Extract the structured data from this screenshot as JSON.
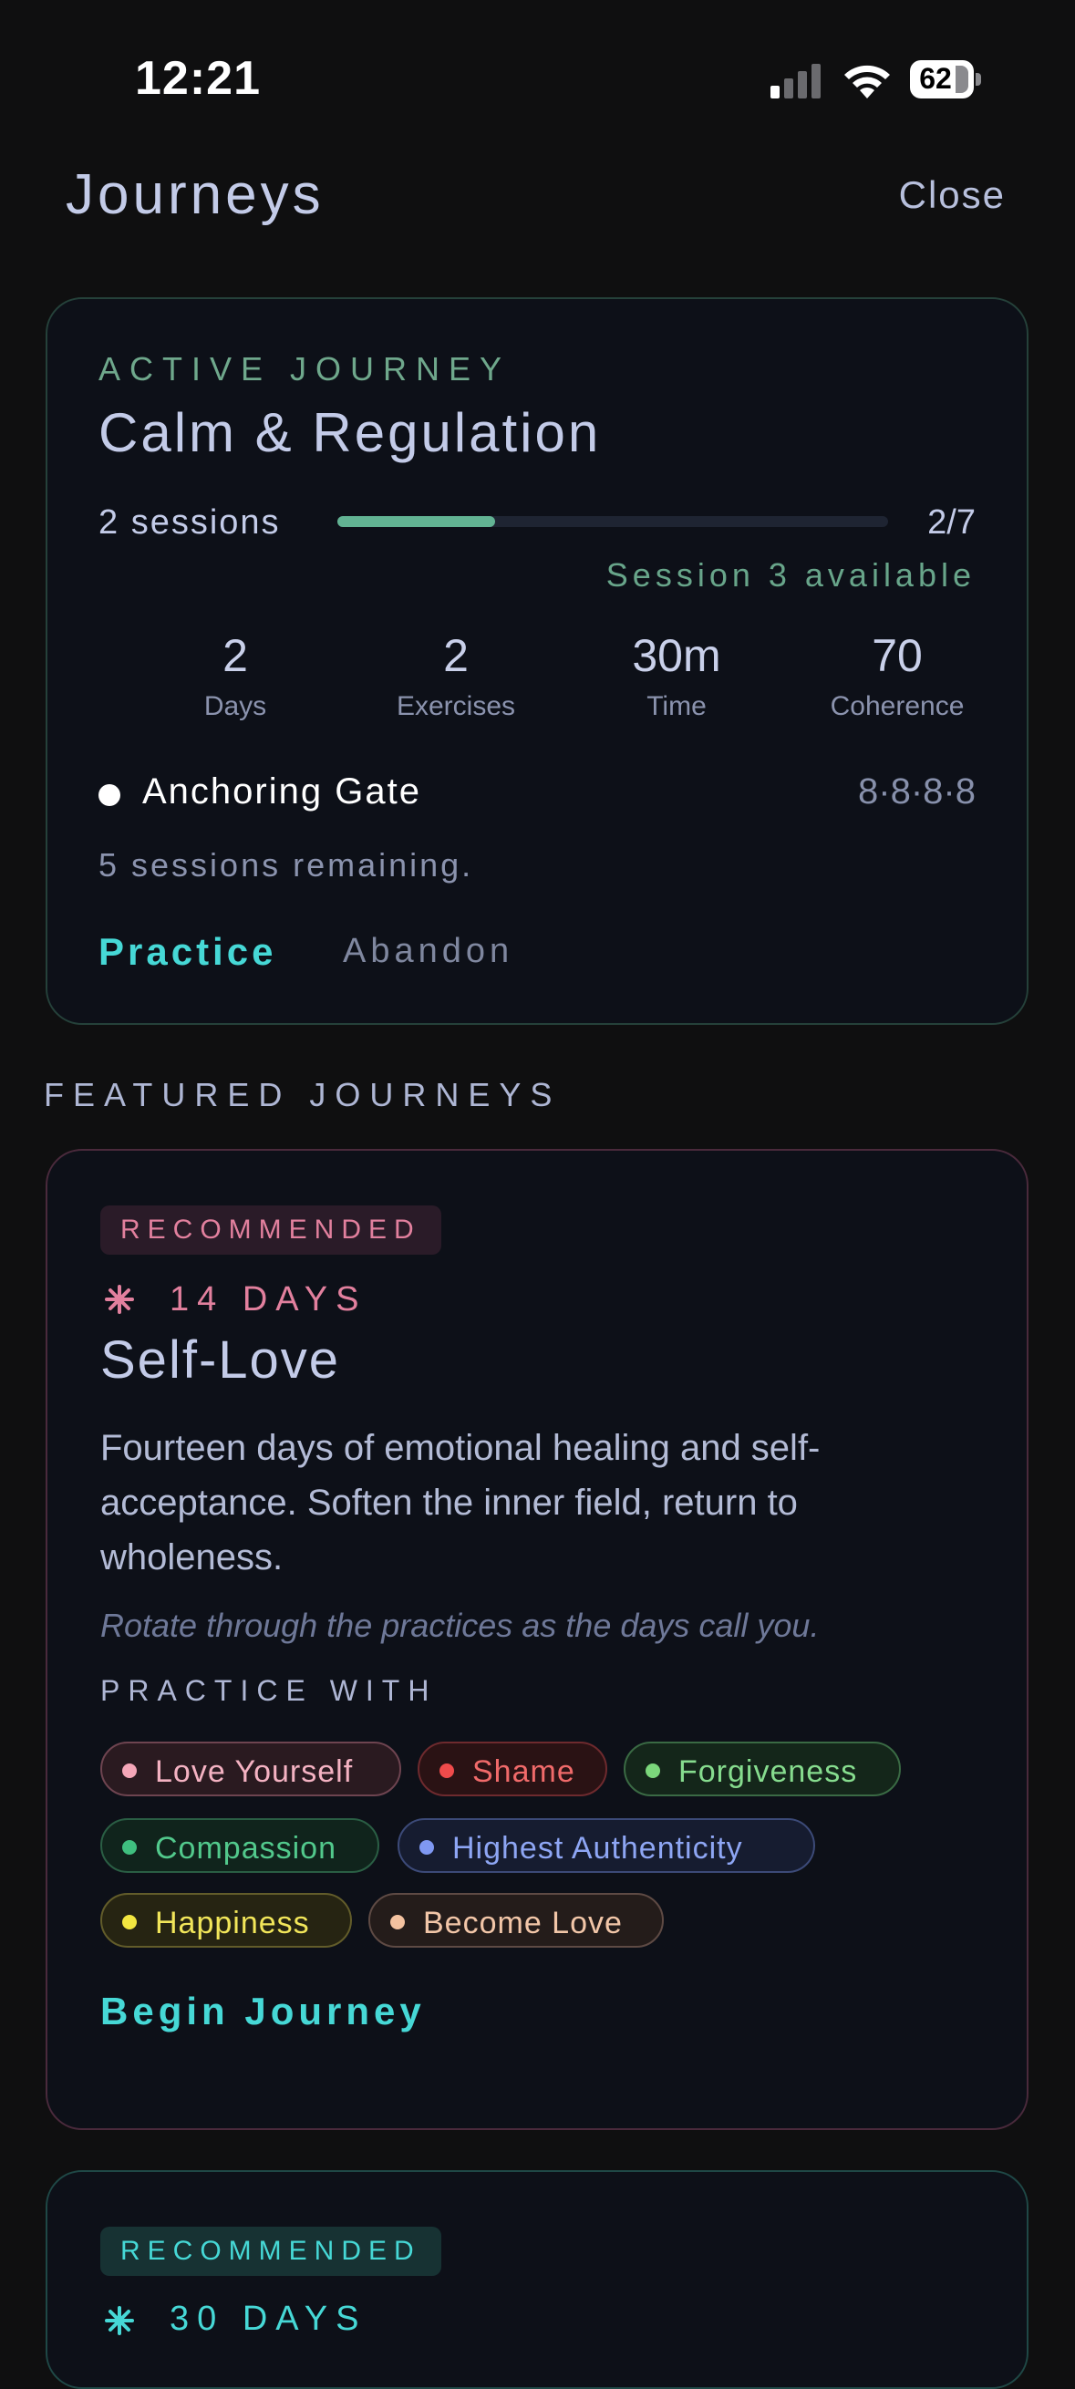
{
  "status": {
    "time": "12:21",
    "battery": "62"
  },
  "header": {
    "title": "Journeys",
    "close_label": "Close"
  },
  "active": {
    "eyebrow": "ACTIVE JOURNEY",
    "title": "Calm & Regulation",
    "sessions_label": "2 sessions",
    "progress": 0.2857,
    "count": "2/7",
    "available": "Session 3 available",
    "stats": [
      {
        "value": "2",
        "label": "Days"
      },
      {
        "value": "2",
        "label": "Exercises"
      },
      {
        "value": "30m",
        "label": "Time"
      },
      {
        "value": "70",
        "label": "Coherence"
      }
    ],
    "gate_name": "Anchoring Gate",
    "gate_code": "8·8·8·8",
    "remaining": "5 sessions remaining.",
    "practice_label": "Practice",
    "abandon_label": "Abandon",
    "accent": "#62b393"
  },
  "featured": {
    "section_label": "FEATURED JOURNEYS",
    "cards": [
      {
        "badge": "RECOMMENDED",
        "icon": "sparkle-icon",
        "days": "14 DAYS",
        "title": "Self-Love",
        "description": "Fourteen days of emotional healing and self-acceptance. Soften the inner field, return to wholeness.",
        "note": "Rotate through the practices as the days call you.",
        "practice_with": "PRACTICE WITH",
        "chips": [
          {
            "label": "Love Yourself",
            "color": "#f4a6b8",
            "bg": "#2a1a20",
            "border": "#6e4450",
            "text": "#f4b2c2"
          },
          {
            "label": "Shame",
            "color": "#ef4b4b",
            "bg": "#2a1214",
            "border": "#6e2a2e",
            "text": "#f06a6a"
          },
          {
            "label": "Forgiveness",
            "color": "#7bd67b",
            "bg": "#14261a",
            "border": "#3a6a44",
            "text": "#86dc8e"
          },
          {
            "label": "Compassion",
            "color": "#3fbf7f",
            "bg": "#10241c",
            "border": "#2a5e44",
            "text": "#52c98c"
          },
          {
            "label": "Highest Authenticity",
            "color": "#7f98f2",
            "bg": "#161c30",
            "border": "#3c4a78",
            "text": "#8ea6f4"
          },
          {
            "label": "Happiness",
            "color": "#f2e640",
            "bg": "#262412",
            "border": "#625c2a",
            "text": "#f2e65a"
          },
          {
            "label": "Become Love",
            "color": "#f4c2a0",
            "bg": "#241c1a",
            "border": "#5e4a44",
            "text": "#f2c6a8"
          }
        ],
        "begin_label": "Begin Journey",
        "accent": "#e2809e"
      },
      {
        "badge": "RECOMMENDED",
        "icon": "sparkle-icon",
        "days": "30 DAYS",
        "accent": "#46d8d6"
      }
    ]
  }
}
